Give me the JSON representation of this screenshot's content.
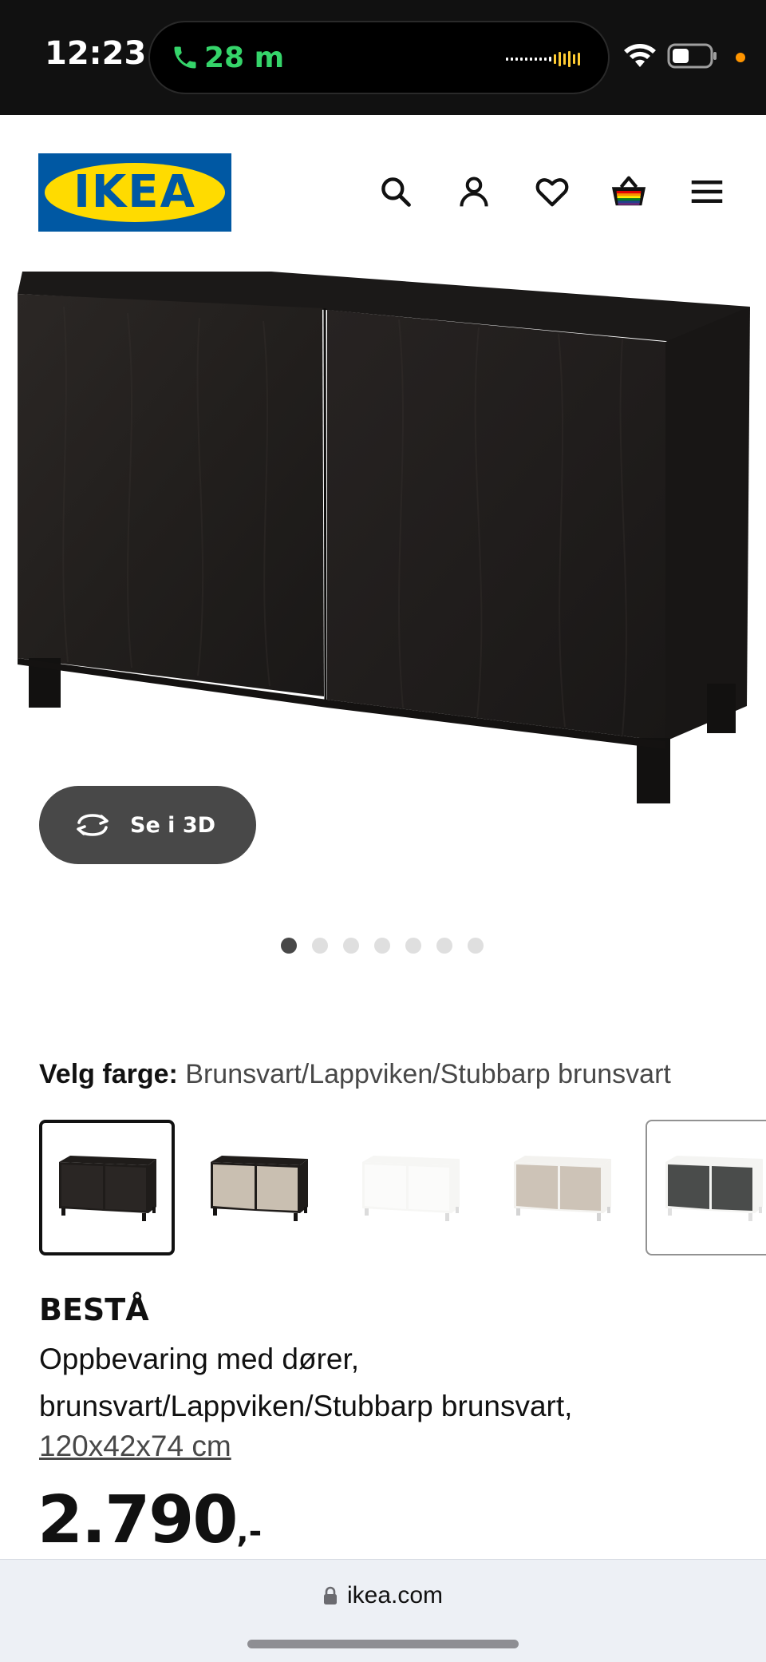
{
  "status_bar": {
    "time": "12:23",
    "call_duration": "28 m",
    "call_color": "#35d46a",
    "icons": [
      "phone-icon",
      "waveform-icon",
      "wifi-icon",
      "battery-icon",
      "privacy-dot"
    ]
  },
  "header": {
    "logo_text": "IKEA",
    "icons": [
      "search-icon",
      "account-icon",
      "heart-icon",
      "shopping-bag-icon",
      "menu-icon"
    ],
    "brand_blue": "#0058a3",
    "brand_yellow": "#ffdb00"
  },
  "gallery": {
    "view_3d_label": "Se i 3D",
    "image_count": 7,
    "active_index": 0
  },
  "color_selector": {
    "label": "Velg farge:",
    "selected_value": "Brunsvart/Lappviken/Stubbarp brunsvart",
    "swatches": [
      {
        "frame": "#1f1c1a",
        "door": "#2a2624",
        "legs": "#151312"
      },
      {
        "frame": "#1f1c1a",
        "door": "#c9bfb1",
        "legs": "#151312"
      },
      {
        "frame": "#f6f6f4",
        "door": "#fbfbfa",
        "legs": "#dcdcdc"
      },
      {
        "frame": "#f3f2ef",
        "door": "#cdc3b7",
        "legs": "#d4d4d4"
      },
      {
        "frame": "#f4f4f2",
        "door": "#4a4c4b",
        "legs": "#e0e0e0"
      }
    ]
  },
  "product": {
    "name": "BESTÅ",
    "description": "Oppbevaring med dører, brunsvart/Lappviken/Stubbarp brunsvart,",
    "dimensions": "120x42x74 cm",
    "price": "2.790",
    "price_suffix": ",-"
  },
  "browser": {
    "url": "ikea.com"
  }
}
